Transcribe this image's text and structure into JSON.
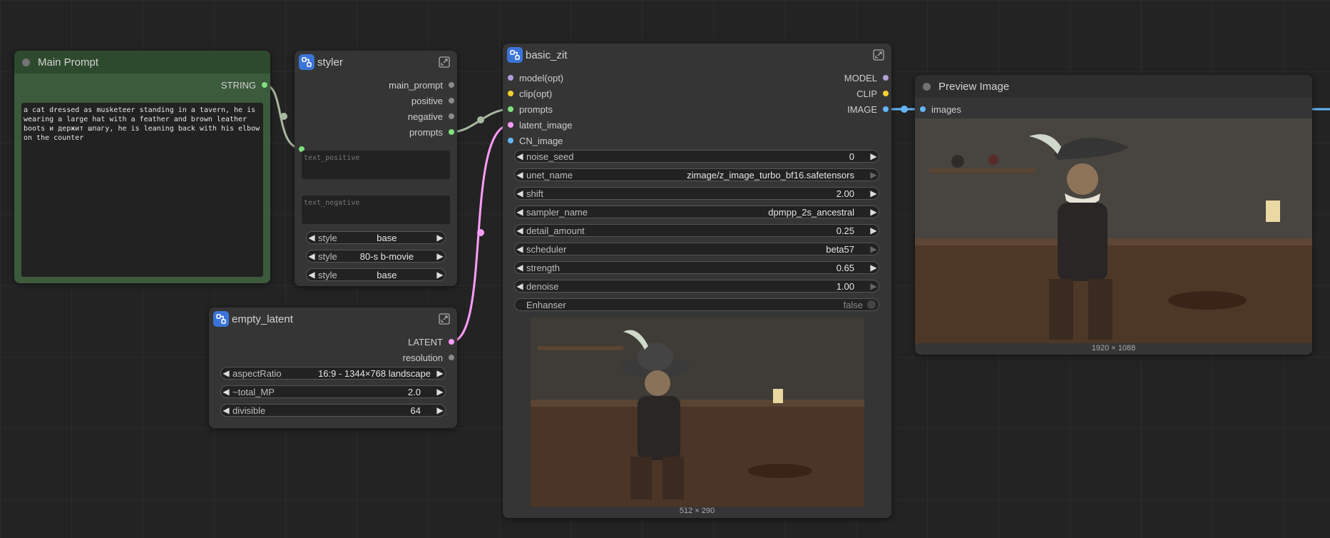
{
  "main_prompt": {
    "title": "Main Prompt",
    "output": "STRING",
    "text": "a cat dressed as musketeer standing in a tavern, he is wearing a large hat with a feather and brown leather boots и держит шпагу, he is leaning back with his elbow on the counter"
  },
  "styler": {
    "title": "styler",
    "outputs": [
      "main_prompt",
      "positive",
      "negative",
      "prompts"
    ],
    "text_positive_placeholder": "text_positive",
    "text_negative_placeholder": "text_negative",
    "widgets": [
      {
        "name": "style",
        "value": "base"
      },
      {
        "name": "style",
        "value": "80-s b-movie"
      },
      {
        "name": "style",
        "value": "base"
      }
    ]
  },
  "empty_latent": {
    "title": "empty_latent",
    "outputs": [
      "LATENT",
      "resolution"
    ],
    "widgets": [
      {
        "name": "aspectRatio",
        "value": "16:9 - 1344×768 landscape"
      },
      {
        "name": "~total_MP",
        "value": "2.0"
      },
      {
        "name": "divisible",
        "value": "64"
      }
    ]
  },
  "basic_zit": {
    "title": "basic_zit",
    "inputs": [
      "model(opt)",
      "clip(opt)",
      "prompts",
      "latent_image",
      "CN_image"
    ],
    "outputs": [
      "MODEL",
      "CLIP",
      "IMAGE"
    ],
    "widgets": [
      {
        "name": "noise_seed",
        "value": "0"
      },
      {
        "name": "unet_name",
        "value": "zimage/z_image_turbo_bf16.safetensors"
      },
      {
        "name": "shift",
        "value": "2.00"
      },
      {
        "name": "sampler_name",
        "value": "dpmpp_2s_ancestral"
      },
      {
        "name": "detail_amount",
        "value": "0.25"
      },
      {
        "name": "scheduler",
        "value": "beta57"
      },
      {
        "name": "strength",
        "value": "0.65"
      },
      {
        "name": "denoise",
        "value": "1.00"
      }
    ],
    "toggle": {
      "name": "Enhanser",
      "value": "false"
    },
    "preview_dims": "512 × 290"
  },
  "preview_image": {
    "title": "Preview Image",
    "input": "images",
    "dims": "1920 × 1088"
  },
  "colors": {
    "string": "#7ee07e",
    "model": "#b39ddb",
    "clip": "#f5d130",
    "latent": "#ff9cf9",
    "image": "#64b5f6",
    "grey_slot": "#8a8a8a",
    "green_node": "#3c5a3c"
  }
}
